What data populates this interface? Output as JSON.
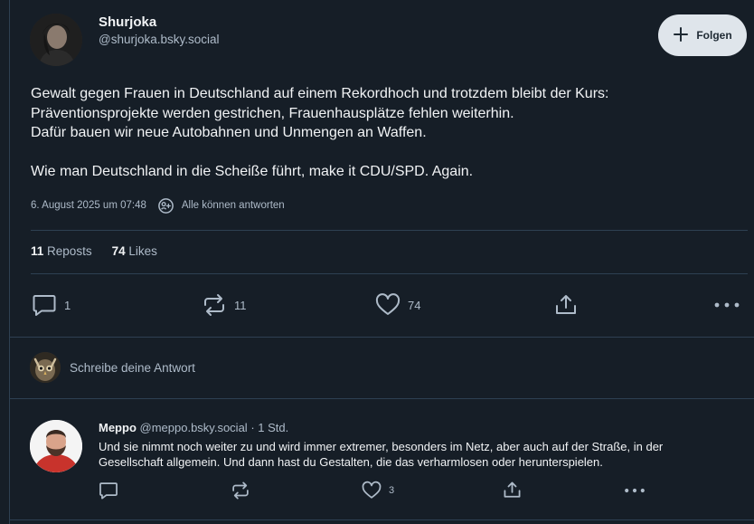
{
  "post": {
    "author_name": "Shurjoka",
    "author_handle": "@shurjoka.bsky.social",
    "follow_label": "Folgen",
    "text_lines": [
      "Gewalt gegen Frauen in Deutschland auf einem Rekordhoch und trotzdem bleibt der Kurs:",
      "Präventionsprojekte werden gestrichen, Frauenhausplätze fehlen weiterhin.",
      "Dafür bauen wir neue Autobahnen und Unmengen an Waffen.",
      "Wie man Deutschland in die Scheiße führt, make it CDU/SPD. Again."
    ],
    "timestamp": "6. August 2025 um 07:48",
    "reply_setting": "Alle können antworten",
    "reposts_count": "11",
    "reposts_label": "Reposts",
    "likes_count": "74",
    "likes_label": "Likes",
    "actions": {
      "reply_count": "1",
      "repost_count": "11",
      "like_count": "74"
    }
  },
  "compose": {
    "placeholder": "Schreibe deine Antwort"
  },
  "reply": {
    "author_name": "Meppo",
    "author_handle": "@meppo.bsky.social",
    "time": "· 1 Std.",
    "text": "Und sie nimmt noch weiter zu und wird immer extremer, besonders im Netz, aber auch auf der Straße, in der Gesellschaft allgemein. Und dann hast du Gestalten, die das verharmlosen oder herunterspielen.",
    "like_count": "3"
  },
  "colors": {
    "background": "#161e27",
    "border": "#2e4052",
    "text_primary": "#f1f3f5",
    "text_secondary": "#aebbc9",
    "follow_button_bg": "#dfe5eb"
  },
  "icons": [
    "plus-icon",
    "reply-settings-icon",
    "comment-icon",
    "repost-icon",
    "heart-icon",
    "share-icon",
    "more-icon"
  ]
}
